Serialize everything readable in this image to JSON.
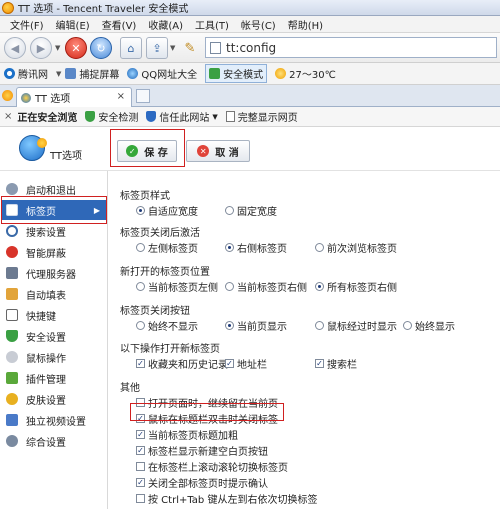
{
  "window": {
    "title": "TT 选项 - Tencent Traveler 安全模式"
  },
  "menu": [
    "文件(F)",
    "编辑(E)",
    "查看(V)",
    "收藏(A)",
    "工具(T)",
    "帐号(C)",
    "帮助(H)"
  ],
  "address": {
    "value": "tt:config"
  },
  "bookmarks": [
    "腾讯网",
    "捕捉屏幕",
    "QQ网址大全",
    "安全模式",
    "27～30℃"
  ],
  "tab": {
    "label": "TT 选项",
    "close": "×"
  },
  "security_bar": {
    "status": "正在安全浏览",
    "items": [
      "安全检测",
      "信任此网站",
      "完整显示网页"
    ]
  },
  "header": {
    "logo_label": "TT选项",
    "save": "保 存",
    "cancel": "取 消"
  },
  "sidebar": {
    "items": [
      {
        "label": "启动和退出"
      },
      {
        "label": "标签页",
        "selected": true
      },
      {
        "label": "搜索设置"
      },
      {
        "label": "智能屏蔽"
      },
      {
        "label": "代理服务器"
      },
      {
        "label": "自动填表"
      },
      {
        "label": "快捷键"
      },
      {
        "label": "安全设置"
      },
      {
        "label": "鼠标操作"
      },
      {
        "label": "插件管理"
      },
      {
        "label": "皮肤设置"
      },
      {
        "label": "独立视频设置"
      },
      {
        "label": "综合设置"
      }
    ]
  },
  "content": {
    "tab_style": {
      "title": "标签页样式",
      "options": [
        "自适应宽度",
        "固定宽度"
      ],
      "selected": 0
    },
    "after_close": {
      "title": "标签页关闭后激活",
      "options": [
        "左侧标签页",
        "右侧标签页",
        "前次浏览标签页"
      ],
      "selected": 1
    },
    "new_tab_pos": {
      "title": "新打开的标签页位置",
      "options": [
        "当前标签页左侧",
        "当前标签页右侧",
        "所有标签页右侧"
      ],
      "selected": 2
    },
    "close_btn": {
      "title": "标签页关闭按钮",
      "options": [
        "始终不显示",
        "当前页显示",
        "鼠标经过时显示",
        "始终显示"
      ],
      "selected": 1
    },
    "open_new": {
      "title": "以下操作打开新标签页",
      "options": [
        "收藏夹和历史记录",
        "地址栏",
        "搜索栏"
      ],
      "checked": [
        true,
        true,
        true
      ]
    },
    "other": {
      "title": "其他",
      "options": [
        {
          "label": "打开页面时，继续留在当前页",
          "checked": false
        },
        {
          "label": "鼠标在标题栏双击时关闭标签",
          "checked": true
        },
        {
          "label": "当前标签页标题加粗",
          "checked": true
        },
        {
          "label": "标签栏显示新建空白页按钮",
          "checked": true
        },
        {
          "label": "在标签栏上滚动滚轮切换标签页",
          "checked": false
        },
        {
          "label": "关闭全部标签页时提示确认",
          "checked": true
        },
        {
          "label": "按 Ctrl+Tab 键从左到右依次切换标签",
          "checked": false
        }
      ]
    }
  },
  "colors": {
    "accent": "#2f68b8",
    "highlight_box": "#d02020"
  }
}
